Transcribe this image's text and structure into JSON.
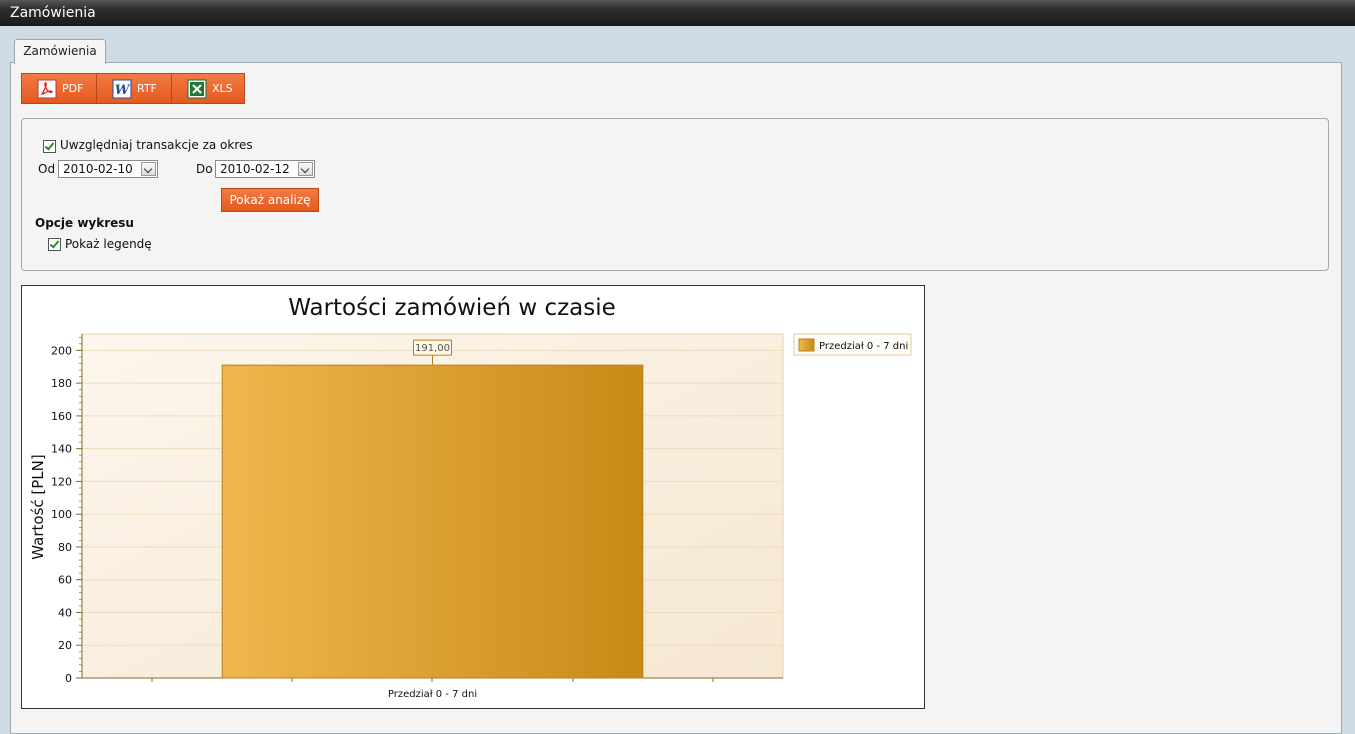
{
  "window": {
    "title": "Zamówienia"
  },
  "tabs": [
    {
      "label": "Zamówienia",
      "active": true
    }
  ],
  "toolbar": {
    "buttons": [
      {
        "label": "PDF",
        "icon": "pdf-icon"
      },
      {
        "label": "RTF",
        "icon": "word-icon"
      },
      {
        "label": "XLS",
        "icon": "excel-icon"
      }
    ]
  },
  "filters": {
    "include_period_label": "Uwzględniaj transakcje za okres",
    "include_period_checked": true,
    "from_label": "Od",
    "from_value": "2010-02-10",
    "to_label": "Do",
    "to_value": "2010-02-12",
    "show_button": "Pokaż analizę",
    "chart_options_title": "Opcje wykresu",
    "show_legend_label": "Pokaż legendę",
    "show_legend_checked": true
  },
  "colors": {
    "accent": "#e8622a",
    "bar_light": "#efb74e",
    "bar_dark": "#c98916",
    "plot_bg": "#fbf2e4"
  },
  "chart_data": {
    "type": "bar",
    "title": "Wartości zamówień w czasie",
    "ylabel": "Wartość [PLN]",
    "xlabel": "",
    "categories": [
      "Przedział 0 - 7 dni"
    ],
    "series": [
      {
        "name": "Przedział 0 - 7 dni",
        "values": [
          191
        ]
      }
    ],
    "data_labels": [
      "191,00"
    ],
    "ylim": [
      0,
      210
    ],
    "yticks": [
      0,
      20,
      40,
      60,
      80,
      100,
      120,
      140,
      160,
      180,
      200
    ],
    "grid": true,
    "legend": "right"
  }
}
